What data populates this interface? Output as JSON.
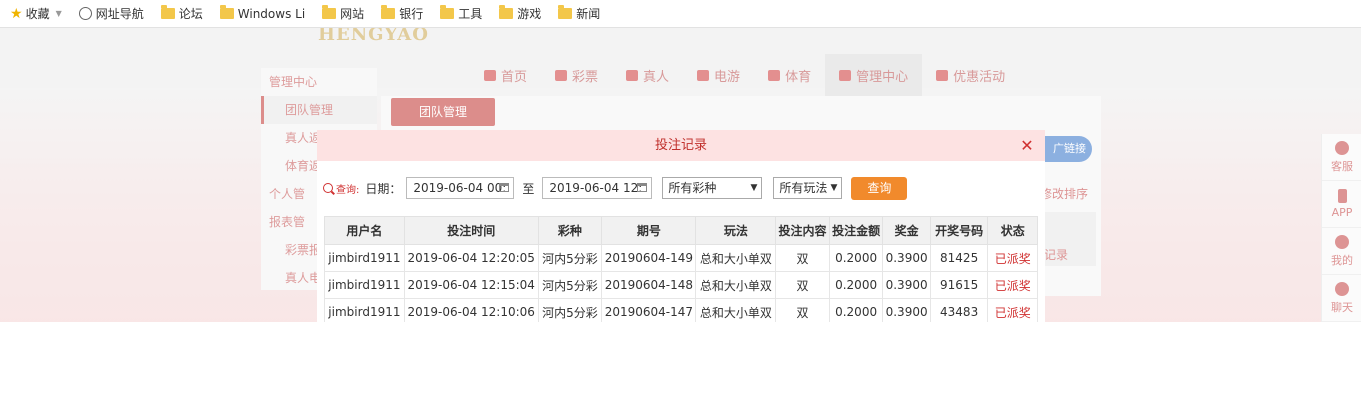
{
  "bookmarks": [
    {
      "label": "收藏",
      "icon": "star-icon"
    },
    {
      "label": "网址导航",
      "icon": "globe-icon"
    },
    {
      "label": "论坛",
      "icon": "folder-icon"
    },
    {
      "label": "Windows Li",
      "icon": "folder-icon"
    },
    {
      "label": "网站",
      "icon": "folder-icon"
    },
    {
      "label": "银行",
      "icon": "folder-icon"
    },
    {
      "label": "工具",
      "icon": "folder-icon"
    },
    {
      "label": "游戏",
      "icon": "folder-icon"
    },
    {
      "label": "新闻",
      "icon": "folder-icon"
    }
  ],
  "site": {
    "logo": "HENGYAO",
    "nav": [
      "首页",
      "彩票",
      "真人",
      "电游",
      "体育",
      "管理中心",
      "优惠活动"
    ],
    "sidebar": [
      {
        "label": "管理中心",
        "head": true
      },
      {
        "label": "团队管理",
        "active": true
      },
      {
        "label": "真人返"
      },
      {
        "label": "体育返"
      },
      {
        "label": "个人管",
        "head": true
      },
      {
        "label": "报表管",
        "head": true
      },
      {
        "label": "彩票报"
      },
      {
        "label": "真人电"
      }
    ],
    "team_button": "团队管理",
    "pill_label": "广链接",
    "sort_label": "修改排序",
    "record_label": "记录",
    "right_panel": [
      "客服",
      "APP",
      "我的",
      "聊天"
    ]
  },
  "modal": {
    "title": "投注记录",
    "close": "✕",
    "query_link": "查询:",
    "date_label": "日期：",
    "date_from": "2019-06-04 00:",
    "to_label": "至",
    "date_to": "2019-06-04 12:",
    "lottery_select": "所有彩种",
    "play_select": "所有玩法",
    "query_button": "查询",
    "columns": [
      "用户名",
      "投注时间",
      "彩种",
      "期号",
      "玩法",
      "投注内容",
      "投注金额",
      "奖金",
      "开奖号码",
      "状态"
    ],
    "rows": [
      [
        "jimbird1911",
        "2019-06-04 12:20:05",
        "河内5分彩",
        "20190604-149",
        "总和大小单双",
        "双",
        "0.2000",
        "0.3900",
        "81425",
        "已派奖"
      ],
      [
        "jimbird1911",
        "2019-06-04 12:15:04",
        "河内5分彩",
        "20190604-148",
        "总和大小单双",
        "双",
        "0.2000",
        "0.3900",
        "91615",
        "已派奖"
      ],
      [
        "jimbird1911",
        "2019-06-04 12:10:06",
        "河内5分彩",
        "20190604-147",
        "总和大小单双",
        "双",
        "0.2000",
        "0.3900",
        "43483",
        "已派奖"
      ]
    ]
  }
}
